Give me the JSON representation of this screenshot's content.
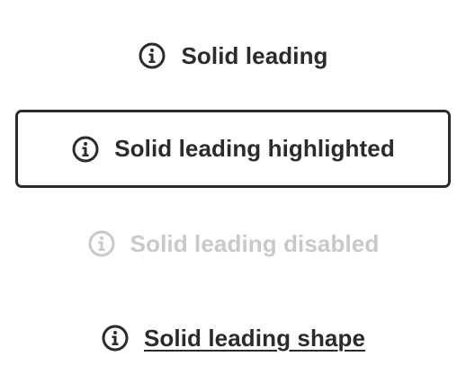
{
  "buttons": {
    "solid_leading": {
      "label": "Solid leading",
      "icon": "info-circle-icon"
    },
    "solid_leading_highlighted": {
      "label": "Solid leading highlighted",
      "icon": "info-circle-icon"
    },
    "solid_leading_disabled": {
      "label": "Solid leading disabled",
      "icon": "info-circle-icon"
    },
    "solid_leading_shape": {
      "label": "Solid leading shape",
      "icon": "info-circle-icon"
    }
  },
  "colors": {
    "foreground": "#2b2b2b",
    "disabled": "#c9c9c9",
    "background": "#ffffff"
  }
}
